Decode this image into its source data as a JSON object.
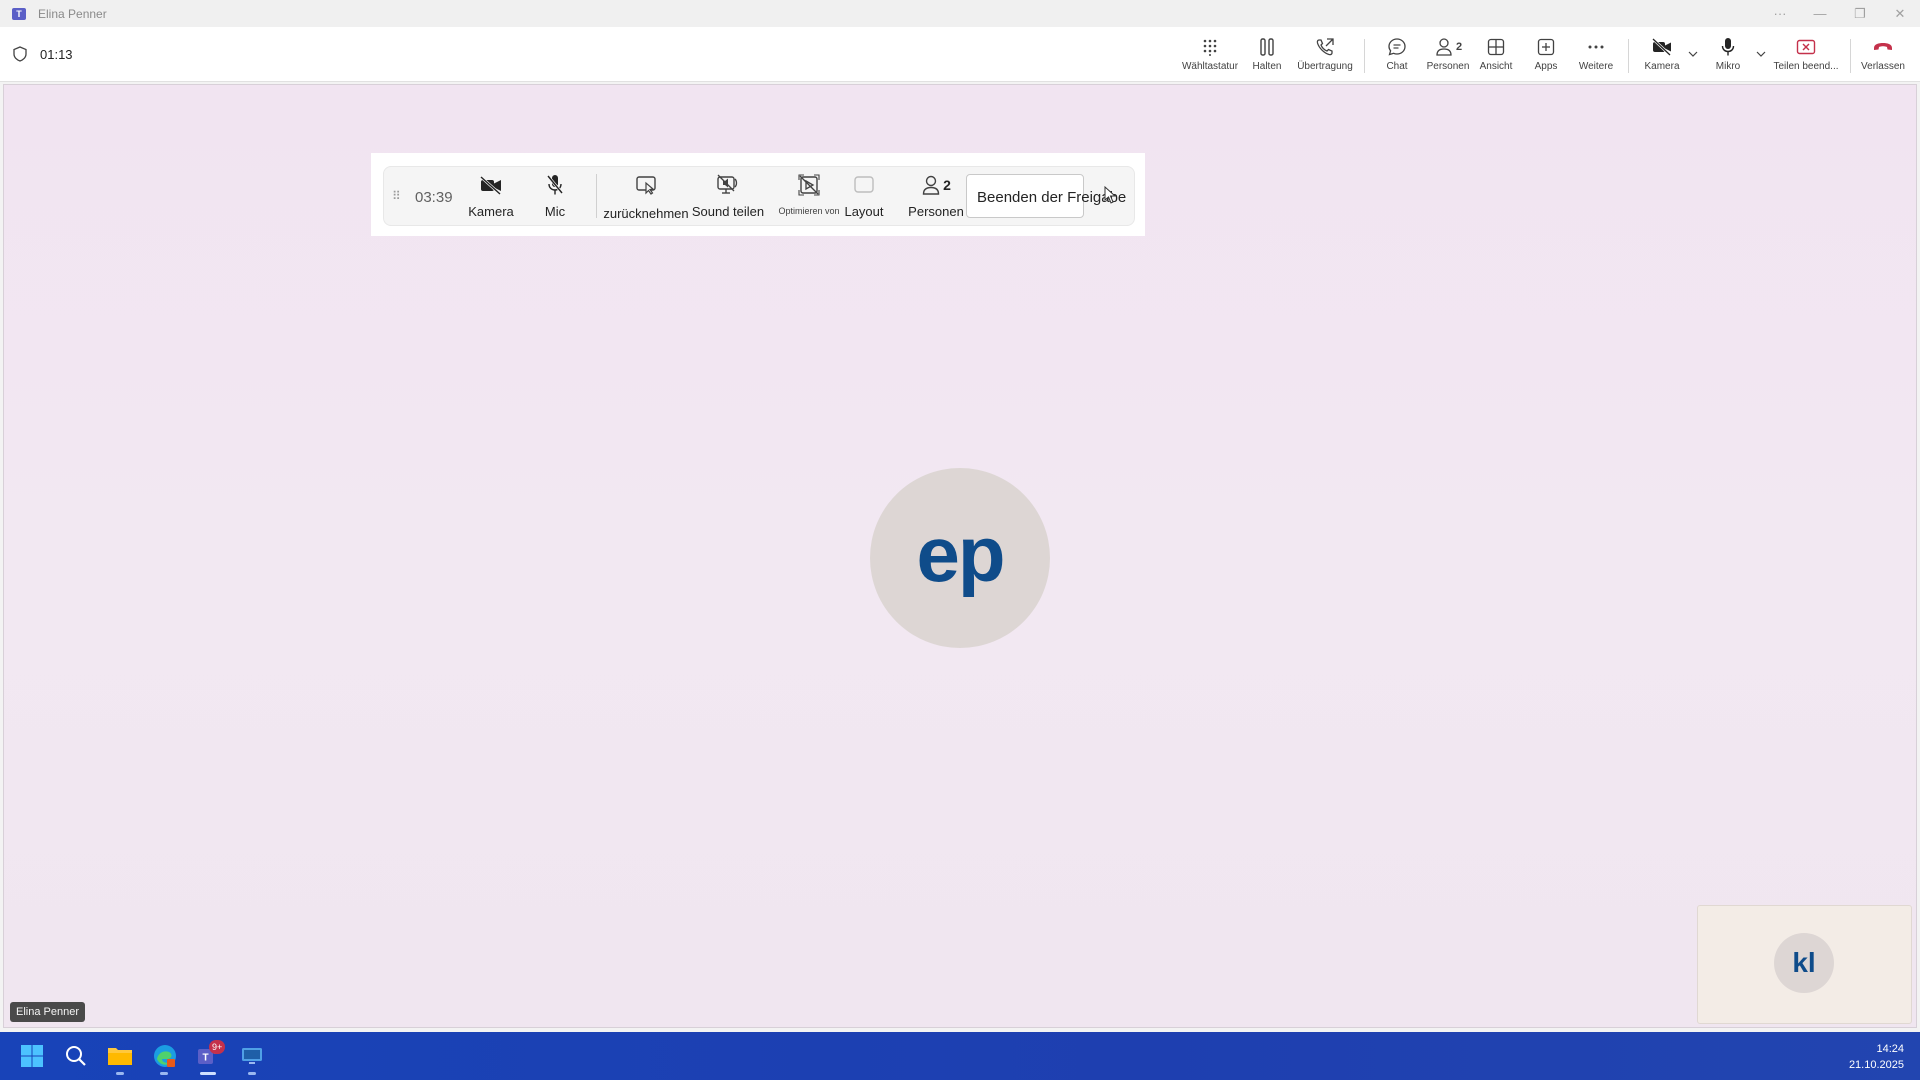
{
  "window": {
    "title": "Elina Penner"
  },
  "meeting": {
    "elapsed": "01:13"
  },
  "toolbar": {
    "dialpad": "Wähltastatur",
    "hold": "Halten",
    "transfer": "Übertragung",
    "chat": "Chat",
    "people": "Personen",
    "people_count": "2",
    "view": "Ansicht",
    "apps": "Apps",
    "more": "Weitere",
    "camera": "Kamera",
    "mic": "Mikro",
    "stop_share": "Teilen beend...",
    "leave": "Verlassen"
  },
  "sharebar": {
    "timer": "03:39",
    "camera": "Kamera",
    "mic": "Mic",
    "take_back": "zurücknehmen",
    "share_sound": "Sound teilen",
    "optimize": "Optimieren von",
    "layout": "Layout",
    "people": "Personen",
    "people_count": "2",
    "stop_sharing": "Beenden der Freigabe"
  },
  "participants": {
    "main_initials": "ep",
    "main_name": "Elina Penner",
    "self_initials": "kl"
  },
  "taskbar": {
    "teams_badge": "9+",
    "time": "14:24",
    "date": "21.10.2025"
  },
  "colors": {
    "accent": "#5b5fc7",
    "leave_red": "#c4314b",
    "avatar_text": "#0f4c8a",
    "taskbar_blue": "#1843b8"
  }
}
